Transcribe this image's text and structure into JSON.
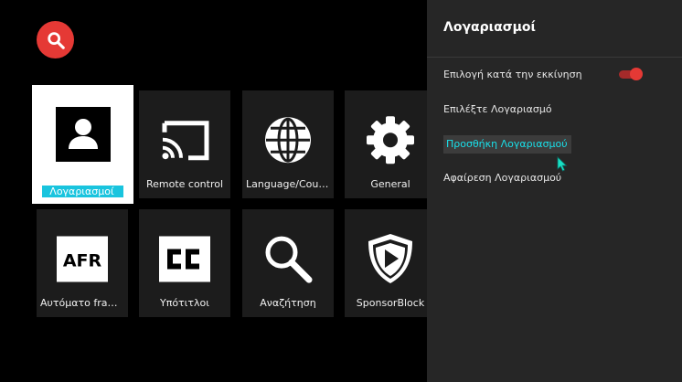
{
  "search": {
    "icon": "search-icon"
  },
  "tiles": [
    {
      "label": "Λογαριασμοί",
      "icon": "account-icon",
      "focused": true
    },
    {
      "label": "Remote control",
      "icon": "cast-icon"
    },
    {
      "label": "Language/Country",
      "icon": "globe-icon"
    },
    {
      "label": "General",
      "icon": "gear-icon"
    },
    {
      "label": "Αυτόματο frame…",
      "icon": "afr-icon"
    },
    {
      "label": "Υπότιτλοι",
      "icon": "cc-icon"
    },
    {
      "label": "Αναζήτηση",
      "icon": "search-icon"
    },
    {
      "label": "SponsorBlock",
      "icon": "sponsorblock-icon"
    }
  ],
  "panel": {
    "title": "Λογαριασμοί",
    "items": [
      {
        "label": "Επιλογή κατά την εκκίνηση",
        "toggle": true
      },
      {
        "label": "Επιλέξτε Λογαριασμό"
      },
      {
        "label": "Προσθήκη Λογαριασμού",
        "selected": true
      },
      {
        "label": "Αφαίρεση Λογαριασμού"
      }
    ]
  },
  "colors": {
    "accent": "#e53935",
    "focus": "#19c4de",
    "panel": "#262626"
  }
}
